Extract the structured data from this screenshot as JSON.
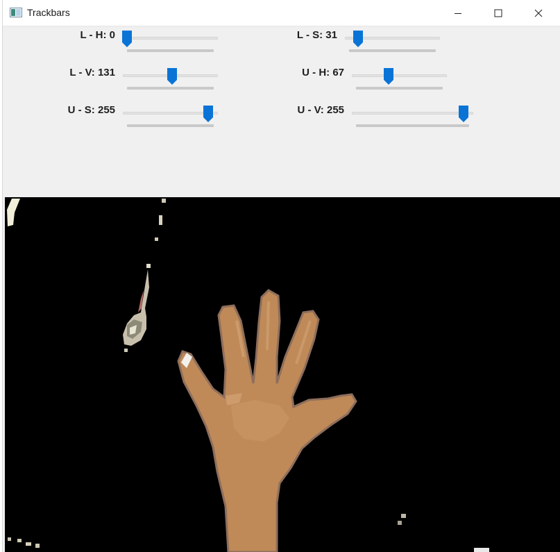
{
  "window": {
    "title": "Trackbars",
    "icon": "opencv-window-icon"
  },
  "controls": {
    "minimize_icon": "minimize-icon",
    "maximize_icon": "maximize-icon",
    "close_icon": "close-icon"
  },
  "trackbars": [
    {
      "label": "L - H: 0",
      "value": 0,
      "max": 179
    },
    {
      "label": "L - S: 31",
      "value": 31,
      "max": 255
    },
    {
      "label": "L - V: 131",
      "value": 131,
      "max": 255
    },
    {
      "label": "U - H: 67",
      "value": 67,
      "max": 179
    },
    {
      "label": "U - S: 255",
      "value": 255,
      "max": 255
    },
    {
      "label": "U - V: 255",
      "value": 255,
      "max": 255
    }
  ],
  "colors": {
    "thumb": "#0a74d6",
    "panel_bg": "#f0f0f0",
    "video_bg": "#000000",
    "skin": "#c8935e"
  }
}
